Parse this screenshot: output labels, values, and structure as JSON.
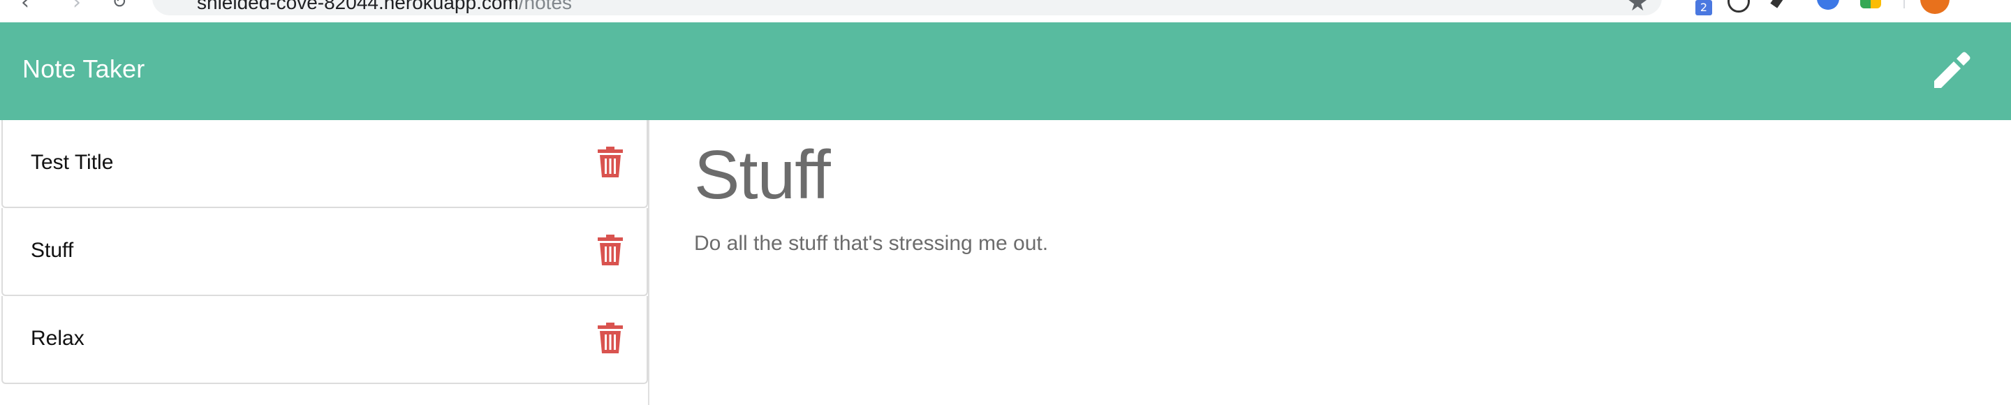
{
  "browser": {
    "url_host": "shielded-cove-82044.herokuapp.com",
    "url_path": "/notes",
    "extension_badge": "2"
  },
  "app": {
    "title": "Note Taker",
    "header_color": "#58bb9f",
    "new_note_icon": "pencil-icon"
  },
  "notes": [
    {
      "title": "Test Title",
      "delete_icon": "trash-icon"
    },
    {
      "title": "Stuff",
      "delete_icon": "trash-icon"
    },
    {
      "title": "Relax",
      "delete_icon": "trash-icon"
    }
  ],
  "active_note": {
    "title": "Stuff",
    "text": "Do all the stuff that's stressing me out."
  },
  "colors": {
    "delete": "#d9534f",
    "note_text": "#6c6c6c"
  }
}
